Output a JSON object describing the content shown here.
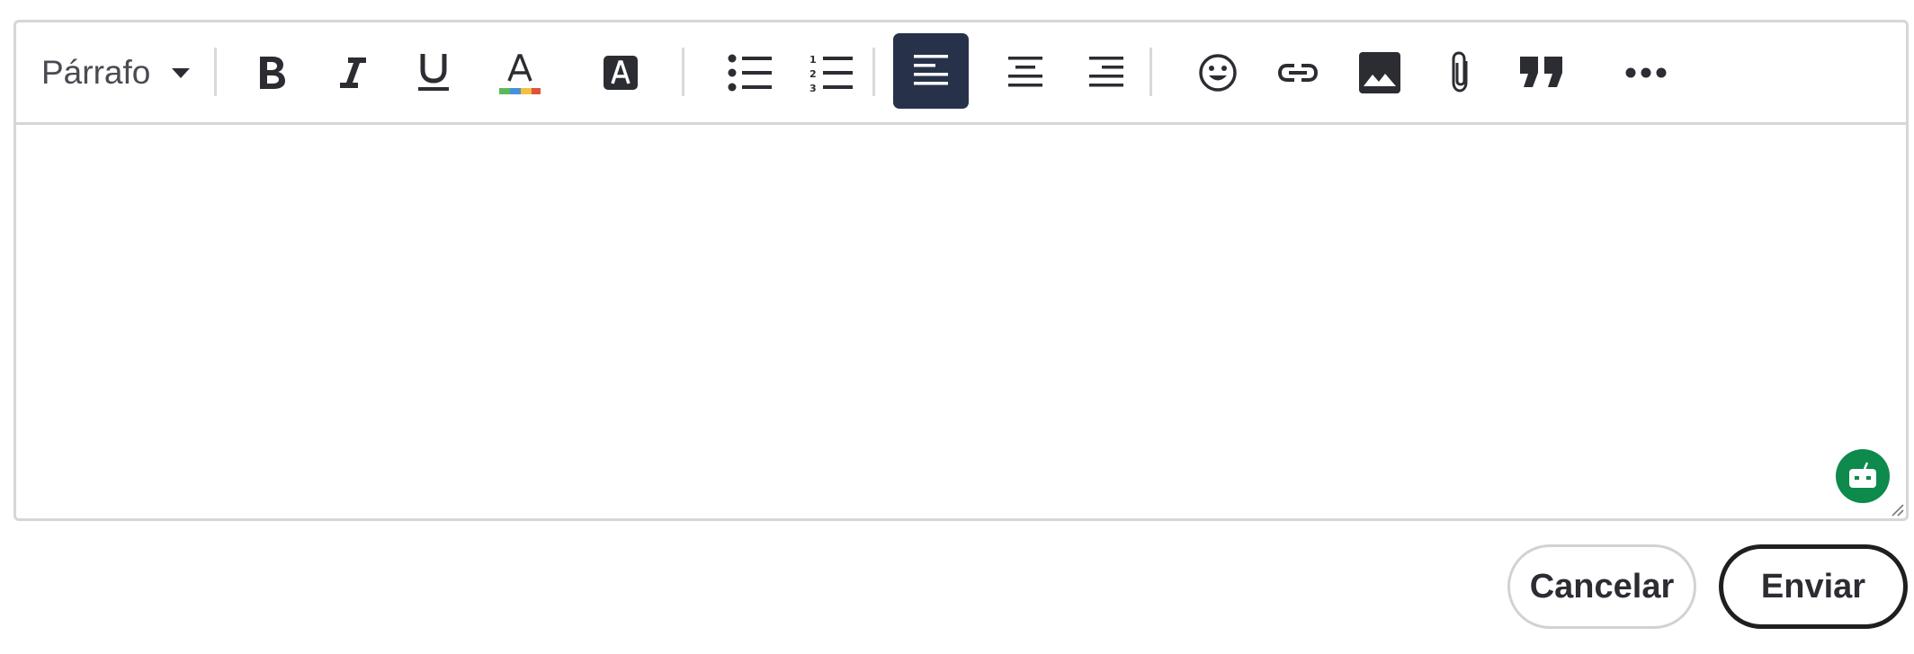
{
  "toolbar": {
    "paragraph_format": {
      "label": "Párrafo",
      "icon": "caret-down-icon"
    },
    "buttons": {
      "bold": {
        "icon": "bold-icon"
      },
      "italic": {
        "icon": "italic-icon"
      },
      "underline": {
        "icon": "underline-icon"
      },
      "font_color": {
        "icon": "font-color-icon",
        "colors": [
          "#5cb85c",
          "#4a90d9",
          "#f0c040",
          "#e0533a"
        ]
      },
      "highlight": {
        "icon": "highlight-icon"
      },
      "bullet_list": {
        "icon": "bullet-list-icon"
      },
      "numbered_list": {
        "icon": "numbered-list-icon"
      },
      "align_left": {
        "icon": "align-left-icon",
        "active": true
      },
      "align_center": {
        "icon": "align-center-icon"
      },
      "align_right": {
        "icon": "align-right-icon"
      },
      "emoji": {
        "icon": "emoji-icon"
      },
      "link": {
        "icon": "link-icon"
      },
      "image": {
        "icon": "image-icon"
      },
      "attachment": {
        "icon": "paperclip-icon"
      },
      "quote": {
        "icon": "quote-icon"
      },
      "more": {
        "icon": "more-icon"
      }
    }
  },
  "editor": {
    "content": "",
    "assistant_icon": "robot-icon"
  },
  "actions": {
    "cancel_label": "Cancelar",
    "send_label": "Enviar"
  },
  "colors": {
    "icon": "#2c2d33",
    "active_bg": "#27324a",
    "border": "#d6d6d6",
    "assistant": "#0d8a4c"
  }
}
